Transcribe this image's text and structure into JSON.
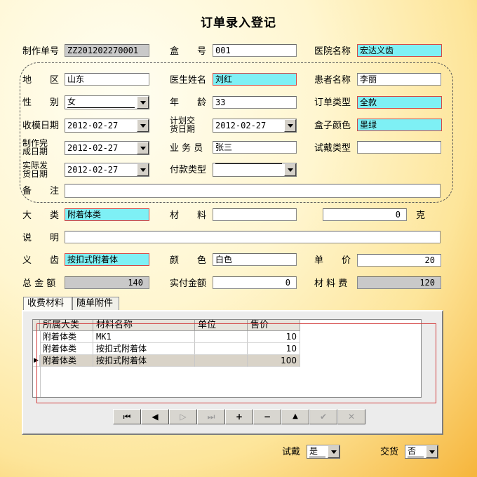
{
  "title": "订单录入登记",
  "labels": {
    "order_no": "制作单号",
    "box_no": "盒　　号",
    "hospital": "医院名称",
    "region": "地　　区",
    "doctor": "医生姓名",
    "patient": "患者名称",
    "gender": "性　　别",
    "age": "年　　龄",
    "order_type": "订单类型",
    "receive_date": "收模日期",
    "plan_date": "计划交货日期",
    "box_color": "盒子颜色",
    "finish_date": "制作完成日期",
    "salesman": "业 务 员",
    "trial_type": "试戴类型",
    "ship_date": "实际发货日期",
    "payment_type": "付款类型",
    "remark": "备　　注",
    "category": "大　　类",
    "material": "材　　料",
    "gram": "克",
    "description": "说　　明",
    "tooth": "义　　齿",
    "color": "颜　　色",
    "unit_price": "单　　价",
    "total": "总 金 额",
    "paid": "实付金额",
    "material_fee": "材 料 费",
    "trial": "试戴",
    "delivery": "交货"
  },
  "fields": {
    "order_no": "ZZ201202270001",
    "box_no": "001",
    "hospital": "宏达义齿",
    "region": "山东",
    "doctor": "刘红",
    "patient": "李丽",
    "gender": "女",
    "age": "33",
    "order_type": "全款",
    "receive_date": "2012-02-27",
    "plan_date": "2012-02-27",
    "box_color": "墨绿",
    "finish_date": "2012-02-27",
    "salesman": "张三",
    "trial_type": "",
    "ship_date": "2012-02-27",
    "payment_type": "",
    "remark": "",
    "category": "附着体类",
    "material": "",
    "gram": "0",
    "description": "",
    "tooth": "按扣式附着体",
    "color": "白色",
    "unit_price": "20",
    "total": "140",
    "paid": "0",
    "material_fee": "120",
    "trial": "是",
    "delivery": "否"
  },
  "tabs": [
    "收费材料",
    "随单附件"
  ],
  "grid": {
    "columns": [
      "所属大类",
      "材料名称",
      "单位",
      "售价"
    ],
    "rows": [
      [
        "附着体类",
        "MK1",
        "",
        "10"
      ],
      [
        "附着体类",
        "按扣式附着体",
        "",
        "10"
      ],
      [
        "附着体类",
        "按扣式附着体",
        "",
        "100"
      ]
    ],
    "row_indicator": "▶"
  },
  "navigator": {
    "first": "⏮",
    "prior": "◀",
    "next": "▷",
    "last": "⏭",
    "insert": "+",
    "delete": "−",
    "edit": "▲",
    "post": "✔",
    "cancel": "✕"
  },
  "colors": {
    "highlight_field": "#7ef0f5",
    "highlight_border": "#d24a4a",
    "readonly_field": "#c9c9c9"
  }
}
